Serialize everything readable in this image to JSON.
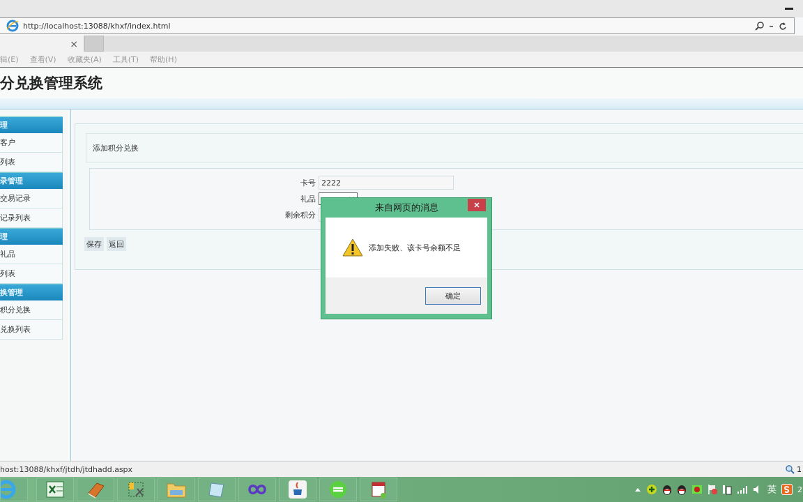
{
  "browser": {
    "url": "http://localhost:13088/khxf/index.html",
    "tab_close": "×",
    "menu": [
      "辑(E)",
      "查看(V)",
      "收藏夹(A)",
      "工具(T)",
      "帮助(H)"
    ]
  },
  "page": {
    "title": "分兑换管理系统",
    "sidebar": [
      {
        "header": "理",
        "items": [
          "客户",
          "列表"
        ]
      },
      {
        "header": "录管理",
        "items": [
          "交易记录",
          "记录列表"
        ]
      },
      {
        "header": "理",
        "items": [
          "礼品",
          "列表"
        ]
      },
      {
        "header": "换管理",
        "items": [
          "积分兑换",
          "兑换列表"
        ]
      }
    ],
    "panel_title": "添加积分兑换",
    "fields": [
      {
        "kind": "text",
        "label": "卡号",
        "value": "2222"
      },
      {
        "kind": "select",
        "label": "礼品"
      },
      {
        "kind": "text",
        "label": "剩余积分"
      }
    ],
    "buttons": [
      "保存",
      "返回"
    ]
  },
  "dialog": {
    "title": "来自网页的消息",
    "message": "添加失败、该卡号余额不足",
    "button": "确定"
  },
  "status_bar": {
    "url": "host:13088/khxf/jtdh/jtdhadd.aspx",
    "zoom": "1"
  },
  "taskbar": {
    "language": "英",
    "clock": "2"
  }
}
